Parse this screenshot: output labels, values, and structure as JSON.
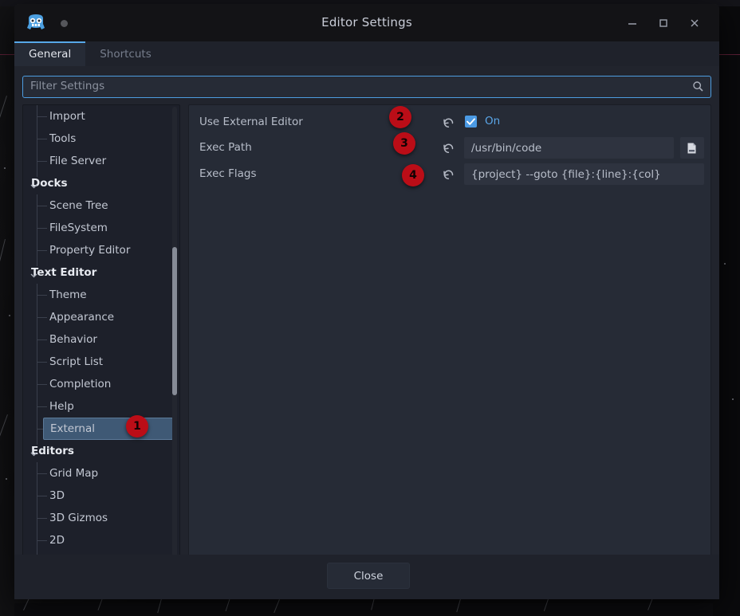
{
  "window": {
    "title": "Editor Settings",
    "app_icon": "godot-icon",
    "status_dot": "unsaved-indicator-dot",
    "controls": {
      "minimize": "minimize-icon",
      "maximize": "maximize-icon",
      "close": "close-icon"
    }
  },
  "tabs": [
    {
      "label": "General",
      "active": true
    },
    {
      "label": "Shortcuts",
      "active": false
    }
  ],
  "search": {
    "placeholder": "Filter Settings",
    "value": "",
    "icon": "search-icon"
  },
  "tree": {
    "items": [
      {
        "label": "Import",
        "type": "child",
        "selected": false
      },
      {
        "label": "Tools",
        "type": "child",
        "selected": false
      },
      {
        "label": "File Server",
        "type": "child",
        "selected": false
      },
      {
        "label": "Docks",
        "type": "group",
        "selected": false
      },
      {
        "label": "Scene Tree",
        "type": "child",
        "selected": false
      },
      {
        "label": "FileSystem",
        "type": "child",
        "selected": false
      },
      {
        "label": "Property Editor",
        "type": "child",
        "selected": false
      },
      {
        "label": "Text Editor",
        "type": "group",
        "selected": false
      },
      {
        "label": "Theme",
        "type": "child",
        "selected": false
      },
      {
        "label": "Appearance",
        "type": "child",
        "selected": false
      },
      {
        "label": "Behavior",
        "type": "child",
        "selected": false
      },
      {
        "label": "Script List",
        "type": "child",
        "selected": false
      },
      {
        "label": "Completion",
        "type": "child",
        "selected": false
      },
      {
        "label": "Help",
        "type": "child",
        "selected": false
      },
      {
        "label": "External",
        "type": "child",
        "selected": true
      },
      {
        "label": "Editors",
        "type": "group",
        "selected": false
      },
      {
        "label": "Grid Map",
        "type": "child",
        "selected": false
      },
      {
        "label": "3D",
        "type": "child",
        "selected": false
      },
      {
        "label": "3D Gizmos",
        "type": "child",
        "selected": false
      },
      {
        "label": "2D",
        "type": "child",
        "selected": false
      }
    ],
    "scrollbar": "tree-scrollbar"
  },
  "settings": {
    "rows": [
      {
        "label": "Use External Editor",
        "kind": "checkbox",
        "value": "On",
        "checked": true,
        "revert_icon": "revert-icon"
      },
      {
        "label": "Exec Path",
        "kind": "text",
        "value": "/usr/bin/code",
        "revert_icon": "revert-icon",
        "browse_icon": "file-browse-icon"
      },
      {
        "label": "Exec Flags",
        "kind": "text",
        "value": "{project} --goto {file}:{line}:{col}",
        "revert_icon": "revert-icon"
      }
    ]
  },
  "badges": [
    {
      "number": "1",
      "target": "tree-item-external"
    },
    {
      "number": "2",
      "target": "row-use-external-editor"
    },
    {
      "number": "3",
      "target": "row-exec-path"
    },
    {
      "number": "4",
      "target": "row-exec-flags"
    }
  ],
  "footer": {
    "close_label": "Close"
  },
  "colors": {
    "accent": "#4d9ce0",
    "checkbox": "#4b9ae4",
    "selection": "#3f5975",
    "badge": "#bb0d17",
    "window_bg": "#1f222b",
    "panel_bg": "#262b36",
    "tree_bg": "#1d202a"
  }
}
